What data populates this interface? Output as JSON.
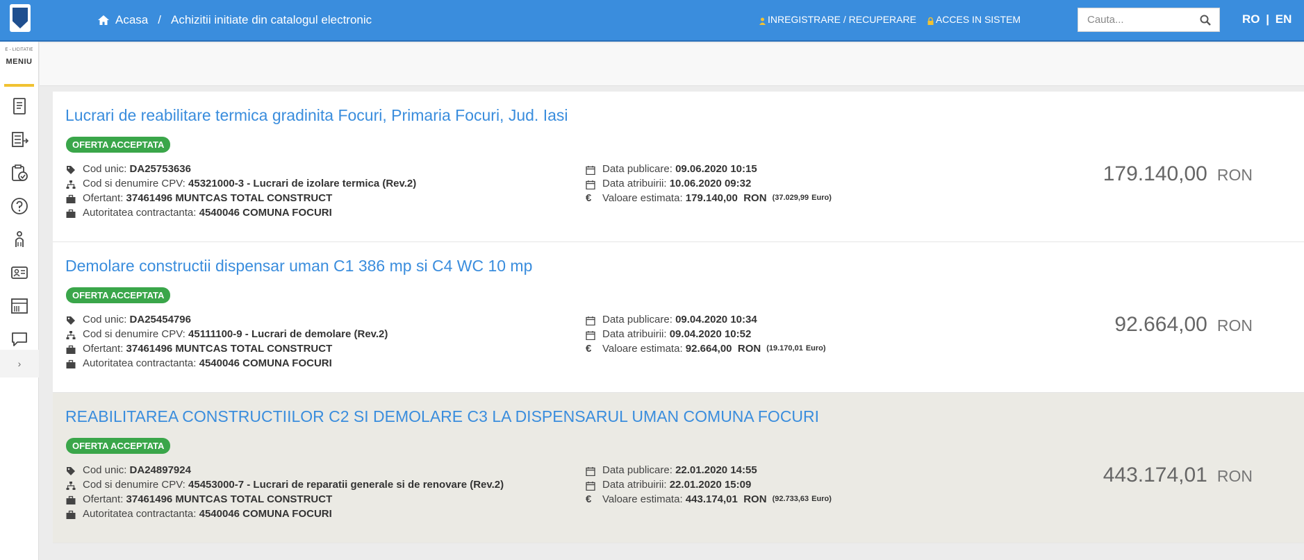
{
  "header": {
    "breadcrumb_home": "Acasa",
    "breadcrumb_sep": "/",
    "breadcrumb_current": "Achizitii initiate din catalogul electronic",
    "link_register": "INREGISTRARE / RECUPERARE",
    "link_login": "ACCES IN SISTEM",
    "search_placeholder": "Cauta...",
    "lang_ro": "RO",
    "lang_sep": "|",
    "lang_en": "EN"
  },
  "sidebar": {
    "brand_small": "E - LICITATIE",
    "brand_menu": "MENIU",
    "toggle": "›",
    "icons": [
      "document-icon",
      "list-export-icon",
      "clipboard-check-icon",
      "help-icon",
      "person-pointer-icon",
      "id-card-icon",
      "catalog-icon",
      "chat-icon"
    ]
  },
  "labels": {
    "cod_unic": "Cod unic:",
    "cpv": "Cod si denumire CPV:",
    "ofertant": "Ofertant:",
    "autoritate": "Autoritatea contractanta:",
    "data_publicare": "Data publicare:",
    "data_atribuire": "Data atribuirii:",
    "valoare": "Valoare estimata:",
    "euro_unit": "Euro",
    "currency": "RON",
    "euro_symbol": "€"
  },
  "colors": {
    "accent": "#3a8ddd",
    "badge": "#3aa64a",
    "alt_row": "#ebeae4"
  },
  "cards": [
    {
      "title": "Lucrari de reabilitare termica gradinita Focuri, Primaria Focuri, Jud. Iasi",
      "status": "OFERTA ACCEPTATA",
      "cod_unic": "DA25753636",
      "cpv": "45321000-3 - Lucrari de izolare termica (Rev.2)",
      "ofertant": "37461496 MUNTCAS TOTAL CONSTRUCT",
      "autoritate": "4540046 COMUNA FOCURI",
      "data_publicare": "09.06.2020 10:15",
      "data_atribuire": "10.06.2020 09:32",
      "valoare_ron": "179.140,00",
      "valoare_euro": "(37.029,99",
      "pret": "179.140,00"
    },
    {
      "title": "Demolare constructii dispensar uman C1 386 mp si C4 WC 10 mp",
      "status": "OFERTA ACCEPTATA",
      "cod_unic": "DA25454796",
      "cpv": "45111100-9 - Lucrari de demolare (Rev.2)",
      "ofertant": "37461496 MUNTCAS TOTAL CONSTRUCT",
      "autoritate": "4540046 COMUNA FOCURI",
      "data_publicare": "09.04.2020 10:34",
      "data_atribuire": "09.04.2020 10:52",
      "valoare_ron": "92.664,00",
      "valoare_euro": "(19.170,01",
      "pret": "92.664,00"
    },
    {
      "title": "REABILITAREA CONSTRUCTIILOR C2 SI DEMOLARE C3 LA DISPENSARUL UMAN COMUNA FOCURI",
      "status": "OFERTA ACCEPTATA",
      "cod_unic": "DA24897924",
      "cpv": "45453000-7 - Lucrari de reparatii generale si de renovare (Rev.2)",
      "ofertant": "37461496 MUNTCAS TOTAL CONSTRUCT",
      "autoritate": "4540046 COMUNA FOCURI",
      "data_publicare": "22.01.2020 14:55",
      "data_atribuire": "22.01.2020 15:09",
      "valoare_ron": "443.174,01",
      "valoare_euro": "(92.733,63",
      "pret": "443.174,01"
    }
  ]
}
